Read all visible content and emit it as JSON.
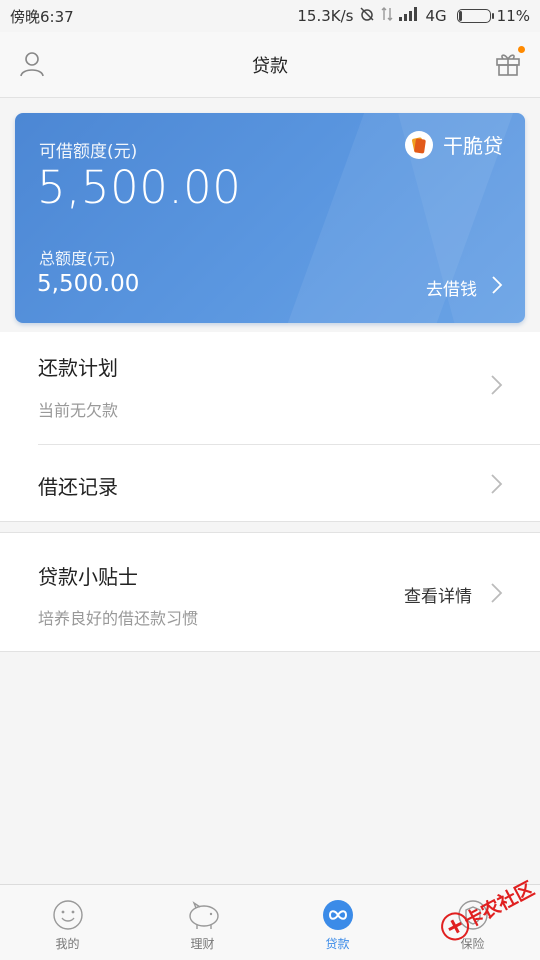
{
  "status_bar": {
    "time": "傍晚6:37",
    "speed": "15.3K/s",
    "network": "4G",
    "battery": "11%",
    "battery_level": 0.11
  },
  "header": {
    "title": "贷款"
  },
  "card": {
    "available_label": "可借额度(元)",
    "available_amount": "5,500.00",
    "total_label": "总额度(元)",
    "total_amount": "5,500.00",
    "brand_name": "干脆贷",
    "borrow_label": "去借钱"
  },
  "repayment_plan": {
    "title": "还款计划",
    "subtitle": "当前无欠款"
  },
  "records": {
    "title": "借还记录"
  },
  "tips": {
    "title": "贷款小贴士",
    "subtitle": "培养良好的借还款习惯",
    "link": "查看详情"
  },
  "tabs": [
    {
      "label": "我的",
      "icon": "smiley-icon"
    },
    {
      "label": "理财",
      "icon": "piggy-bank-icon"
    },
    {
      "label": "贷款",
      "icon": "infinity-icon",
      "active": true
    },
    {
      "label": "保险",
      "icon": "shield-icon"
    }
  ],
  "watermark": {
    "text": "卡农社区"
  },
  "colors": {
    "card_blue": "#4c87d4",
    "accent_blue": "#3b8be8",
    "gift_dot": "#ff8a00"
  }
}
